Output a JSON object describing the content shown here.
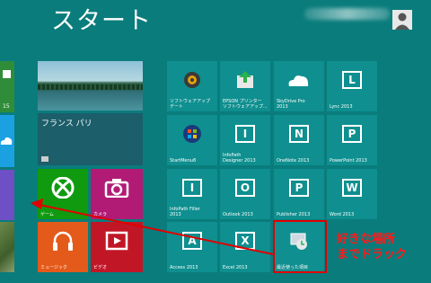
{
  "header": {
    "title": "スタート"
  },
  "left_tiles": {
    "edge_count": "15"
  },
  "tiles": {
    "news": "フランス パリ",
    "games": "ゲーム",
    "camera": "カメラ",
    "music": "ミュージック",
    "video": "ビデオ",
    "software_update": "ソフトウェアアップ\nデート",
    "epson": "EPSON プリンター\nソフトウェアアップ...",
    "skydrive": "SkyDrive Pro\n2013",
    "lync": "Lync 2013",
    "startmenu": "StartMenu8",
    "infopath_designer": "InfoPath\nDesigner 2013",
    "onenote": "OneNote 2013",
    "powerpoint": "PowerPoint 2013",
    "infopath_filler": "InfoPath Filler\n2013",
    "outlook": "Outlook 2013",
    "publisher": "Publisher 2013",
    "word": "Word 2013",
    "access": "Access 2013",
    "excel": "Excel 2013",
    "recent": "最近使った項目"
  },
  "annotation": {
    "text": "好きな場所\nまでドラック"
  },
  "colors": {
    "background": "#0a7c7c",
    "tile": "#0f8f8f",
    "highlight": "#e00000"
  }
}
